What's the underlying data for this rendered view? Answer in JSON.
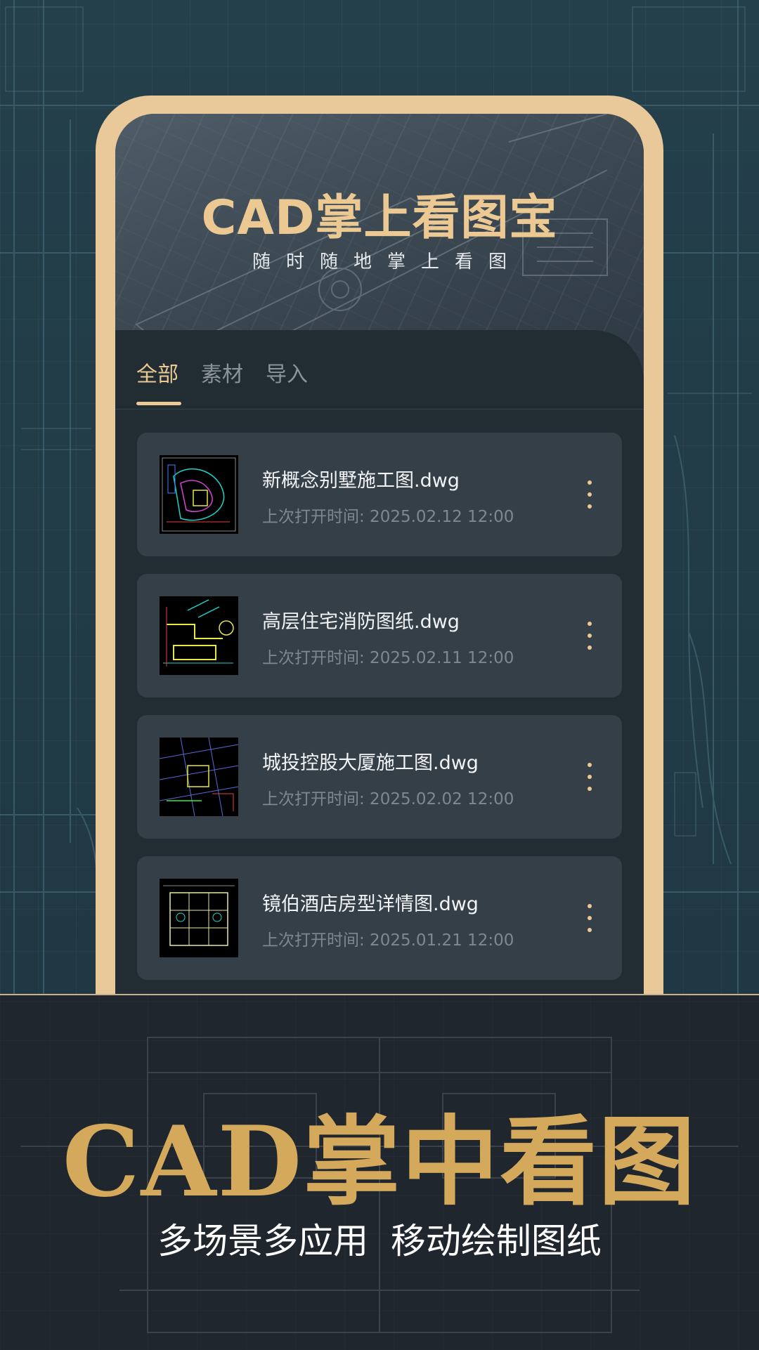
{
  "header": {
    "app_title": "CAD掌上看图宝",
    "app_subtitle": "随时随地掌上看图"
  },
  "tabs": [
    {
      "label": "全部",
      "active": true
    },
    {
      "label": "素材",
      "active": false
    },
    {
      "label": "导入",
      "active": false
    }
  ],
  "files": [
    {
      "name": "新概念别墅施工图.dwg",
      "time": "上次打开时间: 2025.02.12 12:00"
    },
    {
      "name": "高层住宅消防图纸.dwg",
      "time": "上次打开时间: 2025.02.11 12:00"
    },
    {
      "name": "城投控股大厦施工图.dwg",
      "time": "上次打开时间: 2025.02.02 12:00"
    },
    {
      "name": "镜伯酒店房型详情图.dwg",
      "time": "上次打开时间: 2025.01.21 12:00"
    }
  ],
  "promo": {
    "title": "CAD掌中看图",
    "subtitle": "多场景多应用  移动绘制图纸"
  },
  "colors": {
    "accent": "#ecc993",
    "phone_frame": "#e9c99a",
    "card": "#353f48",
    "background": "#213a45",
    "promo_gold": "#d4a95b"
  },
  "icons": {
    "more": "more-vertical-icon",
    "thumbnail": "cad-drawing-thumbnail"
  }
}
